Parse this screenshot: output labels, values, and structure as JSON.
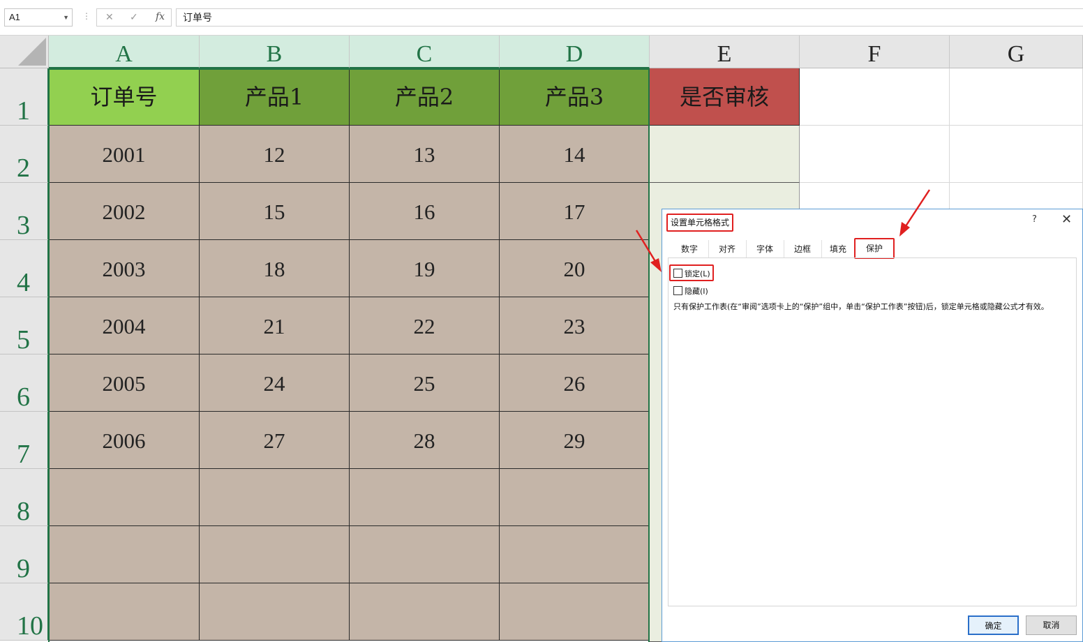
{
  "formula_bar": {
    "name_box": "A1",
    "cancel_icon": "✕",
    "enter_icon": "✓",
    "fx_label": "fx",
    "content": "订单号"
  },
  "columns": [
    "A",
    "B",
    "C",
    "D",
    "E",
    "F",
    "G"
  ],
  "rows": [
    "1",
    "2",
    "3",
    "4",
    "5",
    "6",
    "7",
    "8",
    "9",
    "10"
  ],
  "headers": {
    "a": "订单号",
    "b": "产品1",
    "c": "产品2",
    "d": "产品3",
    "e": "是否审核"
  },
  "table": [
    [
      "2001",
      "12",
      "13",
      "14"
    ],
    [
      "2002",
      "15",
      "16",
      "17"
    ],
    [
      "2003",
      "18",
      "19",
      "20"
    ],
    [
      "2004",
      "21",
      "22",
      "23"
    ],
    [
      "2005",
      "24",
      "25",
      "26"
    ],
    [
      "2006",
      "27",
      "28",
      "29"
    ]
  ],
  "colors": {
    "header_a": "#92d050",
    "header_bcd": "#70a03a",
    "header_e": "#c0504d",
    "data_fill": "#c4b5a8",
    "selection": "#217346",
    "highlight_red": "#e02020"
  },
  "dialog": {
    "title": "设置单元格格式",
    "help": "?",
    "close": "✕",
    "tabs": [
      "数字",
      "对齐",
      "字体",
      "边框",
      "填充",
      "保护"
    ],
    "active_tab": "保护",
    "locked_label": "锁定(L)",
    "locked_checked": false,
    "hidden_label": "隐藏(I)",
    "hidden_checked": false,
    "note": "只有保护工作表(在“审阅”选项卡上的“保护”组中，单击“保护工作表”按钮)后，锁定单元格或隐藏公式才有效。",
    "ok": "确定",
    "cancel": "取消"
  }
}
